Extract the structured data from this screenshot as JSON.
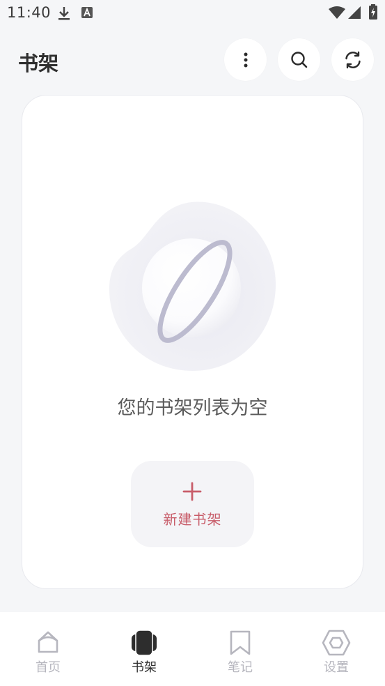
{
  "status_bar": {
    "time": "11:40",
    "icons": [
      "download-icon",
      "a-letter-icon",
      "wifi-icon",
      "signal-icon",
      "battery-icon"
    ]
  },
  "header": {
    "title": "书架",
    "actions": [
      "more-vertical-icon",
      "search-icon",
      "refresh-icon"
    ]
  },
  "empty_state": {
    "message": "您的书架列表为空",
    "new_button_label": "新建书架",
    "illustration": "planet-icon"
  },
  "bottom_nav": {
    "items": [
      {
        "label": "首页",
        "icon": "home-icon",
        "active": false
      },
      {
        "label": "书架",
        "icon": "bookshelf-icon",
        "active": true
      },
      {
        "label": "笔记",
        "icon": "bookmark-icon",
        "active": false
      },
      {
        "label": "设置",
        "icon": "settings-hexagon-icon",
        "active": false
      }
    ]
  },
  "colors": {
    "accent": "#c85d6a",
    "background": "#f5f6f8",
    "card": "#ffffff",
    "nav_inactive": "#b6b6be",
    "nav_active": "#2d2d2d",
    "planet_ring": "#b9b8cd"
  }
}
